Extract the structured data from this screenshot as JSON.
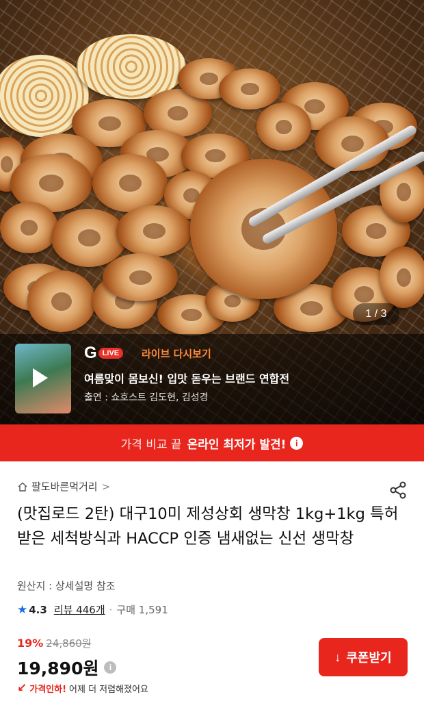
{
  "hero": {
    "image_counter": "1 / 3"
  },
  "live": {
    "logo_letter": "G",
    "logo_pill": "LiVE",
    "tag": "라이브 다시보기",
    "title": "여름맞이 몸보신! 입맛 돋우는 브랜드 연합전",
    "cast": "출연 : 쇼호스트 김도현, 김성경"
  },
  "promo": {
    "light_text": "가격 비교 끝",
    "strong_text": "온라인 최저가 발견!",
    "info_icon": "i"
  },
  "product": {
    "store_name": "팔도바른먹거리",
    "store_chevron": ">",
    "title": "(맛집로드 2탄) 대구10미 제성상회 생막창 1kg+1kg 특허받은 세척방식과 HACCP 인증 냄새없는 신선 생막창",
    "origin": "원산지 : 상세설명 참조",
    "rating_star": "★",
    "rating": "4.3",
    "review_count": "리뷰 446개",
    "separator": "·",
    "purchase_count": "구매 1,591",
    "discount_rate": "19%",
    "original_price": "24,860원",
    "price": "19,890원",
    "price_info_icon": "i",
    "drop_arrow": "↙",
    "drop_highlight": "가격인하!",
    "drop_text": "어제 더 저렴해졌어요",
    "coupon_icon": "↓",
    "coupon_label": "쿠폰받기"
  },
  "colors": {
    "accent_red": "#e8261e",
    "rating_star": "#1c6ce6",
    "live_tag": "#ff8a3d"
  }
}
